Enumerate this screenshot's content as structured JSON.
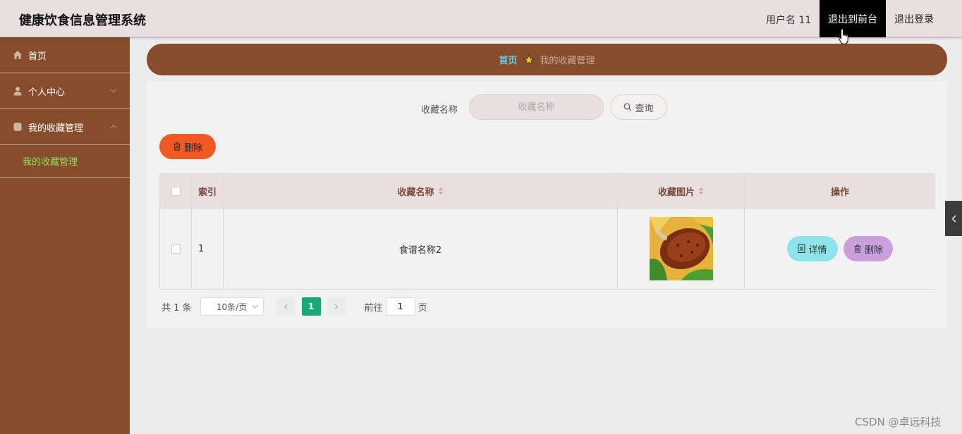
{
  "header": {
    "app_title": "健康饮食信息管理系统",
    "username": "用户名 11",
    "frontend_label": "退出到前台",
    "logout_label": "退出登录"
  },
  "sidebar": {
    "items": [
      {
        "label": "首页",
        "icon": "home-icon"
      },
      {
        "label": "个人中心",
        "icon": "user-icon"
      },
      {
        "label": "我的收藏管理",
        "icon": "database-icon"
      }
    ],
    "sub_item": "我的收藏管理"
  },
  "breadcrumb": {
    "home": "首页",
    "current": "我的收藏管理"
  },
  "search": {
    "label": "收藏名称",
    "placeholder": "收藏名称",
    "query_label": "查询"
  },
  "toolbar": {
    "delete_label": "删除"
  },
  "table": {
    "columns": [
      "索引",
      "收藏名称",
      "收藏图片",
      "操作"
    ],
    "rows": [
      {
        "index": "1",
        "name": "食谱名称2",
        "image": "roast-chicken-leg"
      }
    ],
    "detail_label": "详情",
    "delete_label": "删除"
  },
  "pagination": {
    "total": "共 1 条",
    "page_size": "10条/页",
    "current_page": "1",
    "goto_label": "前往",
    "goto_value": "1",
    "page_suffix": "页"
  },
  "watermark": "CSDN @卓远科技",
  "colors": {
    "sidebar_bg": "#874c2c",
    "header_bg": "#eadfe0",
    "accent_green": "#1aa877",
    "delete_orange": "#f05a22",
    "detail_cyan": "#8ee3ea",
    "row_delete_purple": "#c9a0dc"
  }
}
